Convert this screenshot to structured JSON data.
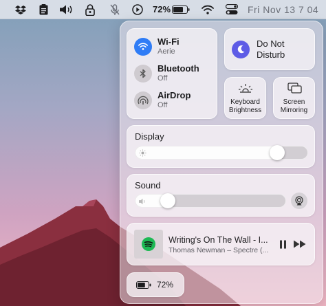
{
  "menubar": {
    "battery_percent": "72%",
    "clock": "Fri Nov 13  7 04",
    "icons": [
      "dropbox-icon",
      "clipboard-icon",
      "volume-icon",
      "lock-icon",
      "mic-off-icon",
      "play-circle-icon",
      "battery-icon",
      "wifi-icon",
      "control-center-icon"
    ]
  },
  "network": {
    "wifi": {
      "title": "Wi-Fi",
      "subtitle": "Aerie",
      "on": true
    },
    "bluetooth": {
      "title": "Bluetooth",
      "subtitle": "Off",
      "on": false
    },
    "airdrop": {
      "title": "AirDrop",
      "subtitle": "Off",
      "on": false
    }
  },
  "do_not_disturb": {
    "label": "Do Not Disturb"
  },
  "keyboard_brightness": {
    "label": "Keyboard Brightness"
  },
  "screen_mirroring": {
    "label": "Screen Mirroring"
  },
  "display": {
    "title": "Display",
    "level": 0.82
  },
  "sound": {
    "title": "Sound",
    "level": 0.22
  },
  "now_playing": {
    "track": "Writing's On The Wall - I...",
    "artist": "Thomas Newman – Spectre (..."
  },
  "battery": {
    "percent": "72%",
    "level": 0.72
  },
  "colors": {
    "accent": "#2f7cf6",
    "dnd": "#5e5ce6",
    "spotify": "#1db954",
    "mountain": "#8a2f3f"
  }
}
